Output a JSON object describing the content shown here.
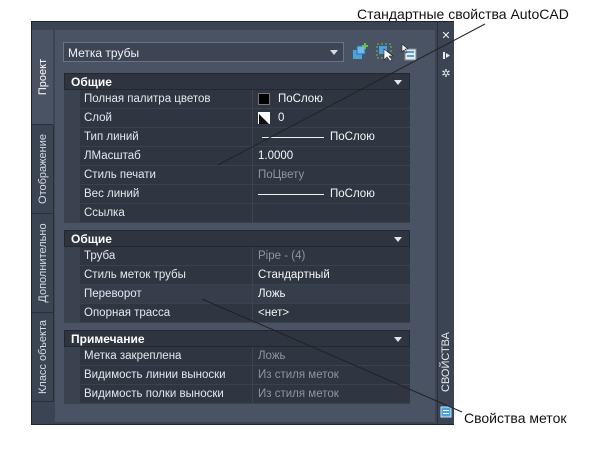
{
  "annotations": {
    "standard": "Стандартные свойства AutoCAD",
    "label_props": "Свойства меток"
  },
  "tabs": [
    "Проект",
    "Отображение",
    "Дополнительно",
    "Класс объекта"
  ],
  "dropdown": {
    "value": "Метка трубы"
  },
  "side_title": "СВОЙСТВА",
  "groups": [
    {
      "title": "Общие",
      "rows": [
        {
          "name": "Полная палитра цветов",
          "value": "ПоСлою",
          "kind": "color"
        },
        {
          "name": "Слой",
          "value": "0",
          "kind": "layer"
        },
        {
          "name": "Тип линий",
          "value": "ПоСлою",
          "kind": "line"
        },
        {
          "name": "ЛМасштаб",
          "value": "1.0000",
          "kind": "text"
        },
        {
          "name": "Стиль печати",
          "value": "ПоЦвету",
          "kind": "dim"
        },
        {
          "name": "Вес линий",
          "value": "ПоСлою",
          "kind": "line"
        },
        {
          "name": "Ссылка",
          "value": "",
          "kind": "text"
        }
      ]
    },
    {
      "title": "Общие",
      "rows": [
        {
          "name": "Труба",
          "value": "Pipe - (4)",
          "kind": "dim"
        },
        {
          "name": "Стиль меток трубы",
          "value": "Стандартный",
          "kind": "text"
        },
        {
          "name": "Переворот",
          "value": "Ложь",
          "kind": "text"
        },
        {
          "name": "Опорная трасса",
          "value": "<нет>",
          "kind": "text"
        }
      ]
    },
    {
      "title": "Примечание",
      "rows": [
        {
          "name": "Метка закреплена",
          "value": "Ложь",
          "kind": "dim"
        },
        {
          "name": "Видимость линии выноски",
          "value": "Из стиля меток",
          "kind": "dim"
        },
        {
          "name": "Видимость полки выноски",
          "value": "Из стиля меток",
          "kind": "dim"
        }
      ]
    }
  ],
  "colors": {
    "panel": "#3b4453",
    "grid": "#2f3642",
    "group_header": "#2e3440",
    "accent_blue": "#4aa3df",
    "accent_green": "#6cc04a"
  },
  "icons": [
    "add-style-icon",
    "select-objects-icon",
    "pick-add-icon",
    "close-icon",
    "auto-hide-icon",
    "settings-icon",
    "quick-properties-icon"
  ]
}
